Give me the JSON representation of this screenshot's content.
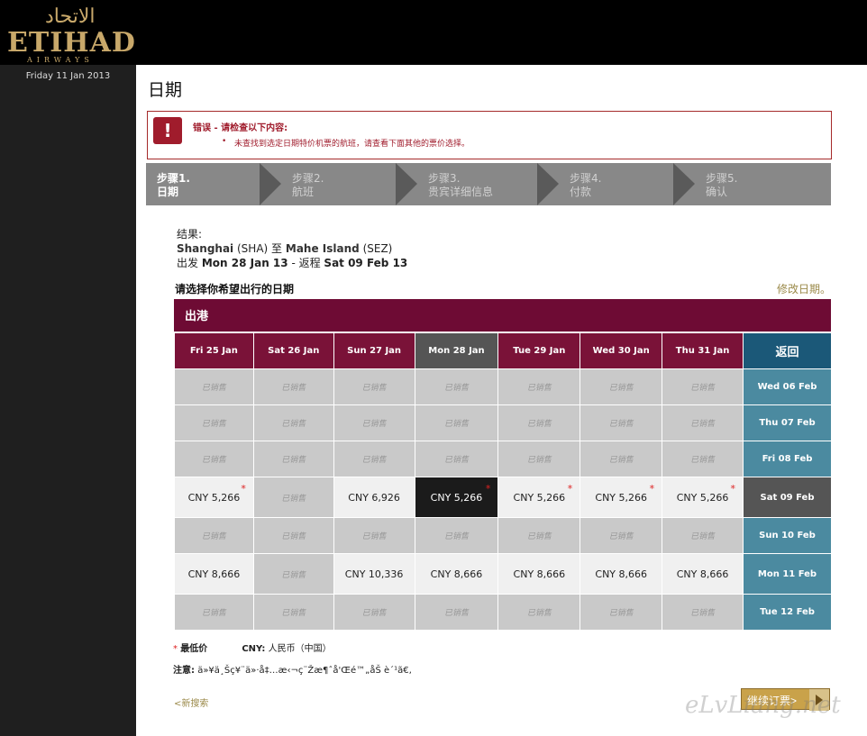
{
  "brand": {
    "arabic": "الاتحاد",
    "wordmark": "ETIHAD",
    "sub": "AIRWAYS"
  },
  "sidebar": {
    "date": "Friday 11 Jan 2013"
  },
  "page_title": "日期",
  "error": {
    "icon": "!",
    "title": "错误 - 请检查以下内容:",
    "items": [
      "未查找到选定日期特价机票的航班，请查看下面其他的票价选择。"
    ]
  },
  "steps": [
    {
      "num": "步骤1.",
      "label": "日期",
      "active": true
    },
    {
      "num": "步骤2.",
      "label": "航班",
      "active": false
    },
    {
      "num": "步骤3.",
      "label": "贵宾详细信息",
      "active": false
    },
    {
      "num": "步骤4.",
      "label": "付款",
      "active": false
    },
    {
      "num": "步骤5.",
      "label": "确认",
      "active": false
    }
  ],
  "results": {
    "label": "结果:",
    "origin_city": "Shanghai",
    "origin_code": "(SHA)",
    "to": "至",
    "dest_city": "Mahe Island",
    "dest_code": "(SEZ)",
    "depart_prefix": "出发",
    "depart_date": "Mon 28 Jan 13",
    "return_prefix": "- 返程",
    "return_date": "Sat 09 Feb 13"
  },
  "select_heading": "请选择你希望出行的日期",
  "change_dates": "修改日期。",
  "outbound_label": "出港",
  "grid": {
    "outbound_dates": [
      "Fri 25 Jan",
      "Sat 26 Jan",
      "Sun 27 Jan",
      "Mon 28 Jan",
      "Tue 29 Jan",
      "Wed 30 Jan",
      "Thu 31 Jan"
    ],
    "return_header": "返回",
    "sold_out": "已销售",
    "rows": [
      {
        "return_date": "Wed 06 Feb",
        "cells": [
          "",
          "",
          "",
          "",
          "",
          "",
          ""
        ]
      },
      {
        "return_date": "Thu 07 Feb",
        "cells": [
          "",
          "",
          "",
          "",
          "",
          "",
          ""
        ]
      },
      {
        "return_date": "Fri 08 Feb",
        "cells": [
          "",
          "",
          "",
          "",
          "",
          "",
          ""
        ]
      },
      {
        "return_date": "Sat 09 Feb",
        "cells": [
          "CNY 5,266",
          "",
          "CNY 6,926",
          "CNY 5,266",
          "CNY 5,266",
          "CNY 5,266",
          "CNY 5,266"
        ]
      },
      {
        "return_date": "Sun 10 Feb",
        "cells": [
          "",
          "",
          "",
          "",
          "",
          "",
          ""
        ]
      },
      {
        "return_date": "Mon 11 Feb",
        "cells": [
          "CNY 8,666",
          "",
          "CNY 10,336",
          "CNY 8,666",
          "CNY 8,666",
          "CNY 8,666",
          "CNY 8,666"
        ]
      },
      {
        "return_date": "Tue 12 Feb",
        "cells": [
          "",
          "",
          "",
          "",
          "",
          "",
          ""
        ]
      }
    ]
  },
  "legend": {
    "star": "*",
    "lowest": "最低价",
    "currency_code": "CNY:",
    "currency_name": "人民币（中国）"
  },
  "notice": {
    "label": "注意:",
    "text": "ä»¥ä¸Šç¥¨ä»·å‡…æ‹¬ç¨Žæ¶ˆå'Œé™„åŠ è´¹ã€‚"
  },
  "new_search": "<新搜索",
  "continue_label": "继续订票>",
  "watermark": "eLvLiang.net",
  "colors": {
    "brand_maroon": "#6e0b34",
    "return_teal": "#4b8aa0",
    "gold": "#c9a24a",
    "error_red": "#a01c2c"
  }
}
